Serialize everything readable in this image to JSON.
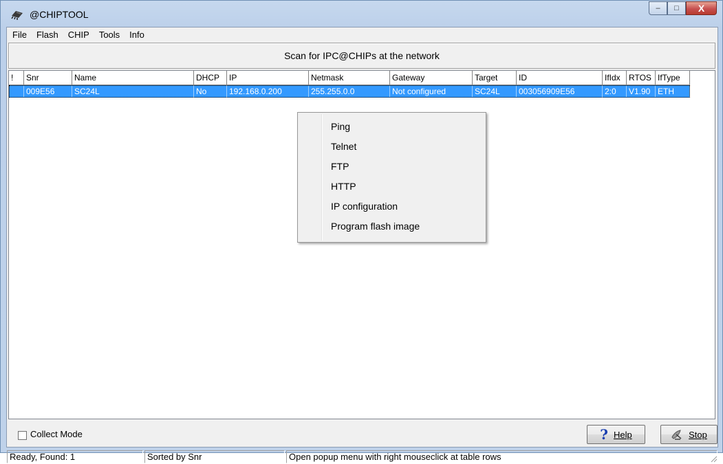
{
  "window": {
    "title": "@CHIPTOOL",
    "controls": {
      "minimize": "–",
      "maximize": "□",
      "close": "X"
    }
  },
  "menubar": {
    "items": [
      "File",
      "Flash",
      "CHIP",
      "Tools",
      "Info"
    ]
  },
  "scan_button": {
    "label": "Scan for IPC@CHIPs at the network"
  },
  "table": {
    "columns": [
      "!",
      "Snr",
      "Name",
      "DHCP",
      "IP",
      "Netmask",
      "Gateway",
      "Target",
      "ID",
      "IfIdx",
      "RTOS",
      "IfType"
    ],
    "rows": [
      {
        "cells": [
          "",
          "009E56",
          "SC24L",
          "No",
          "192.168.0.200",
          "255.255.0.0",
          "Not configured",
          "SC24L",
          "003056909E56",
          "2:0",
          "V1.90",
          "ETH"
        ],
        "selected": true
      }
    ]
  },
  "context_menu": {
    "items": [
      "Ping",
      "Telnet",
      "FTP",
      "HTTP",
      "IP configuration",
      "Program flash image"
    ]
  },
  "bottom": {
    "collect_mode": {
      "label": "Collect Mode",
      "checked": false
    },
    "help_button": {
      "label": "Help"
    },
    "stop_button": {
      "label": "Stop"
    }
  },
  "statusbar": {
    "ready": "Ready,  Found: 1",
    "sorted": "Sorted by Snr",
    "hint": "Open popup menu with right mouseclick at table rows"
  },
  "colors": {
    "selection": "#3399ff",
    "window_frame": "#bcd0ea",
    "close_button": "#c75050"
  }
}
